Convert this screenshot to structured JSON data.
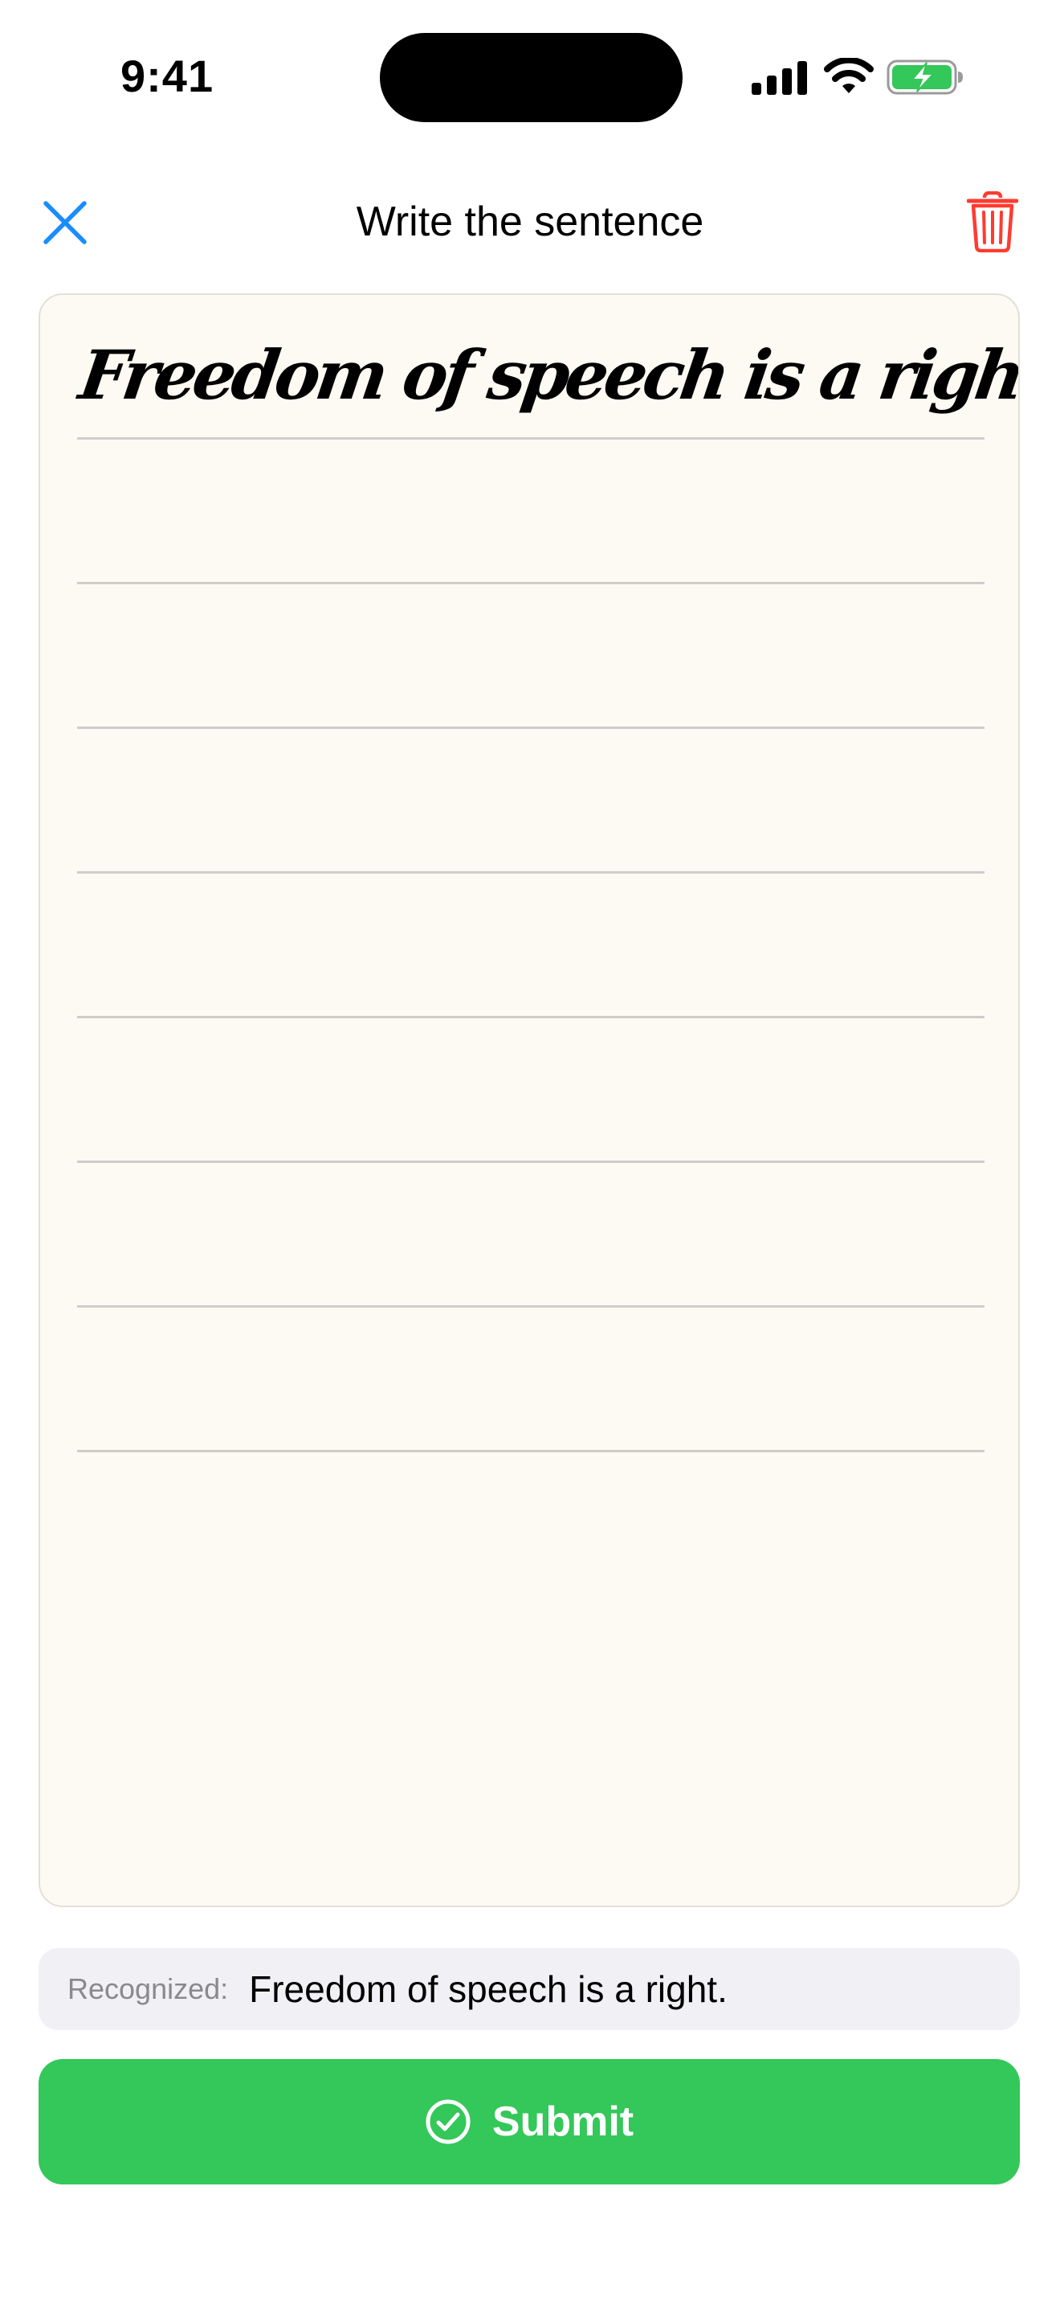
{
  "status_bar": {
    "time": "9:41",
    "icons": [
      "cellular-signal-icon",
      "wifi-icon",
      "battery-charging-icon"
    ]
  },
  "nav": {
    "title": "Write the sentence",
    "close_icon": "close-icon",
    "delete_icon": "trash-icon"
  },
  "writing_area": {
    "prompt_sentence": "Freedom of speech is a right.",
    "ruled_line_count": 8
  },
  "recognized": {
    "label": "Recognized:",
    "text": "Freedom of speech is a right."
  },
  "submit": {
    "label": "Submit",
    "icon": "checkmark-circle-icon"
  },
  "colors": {
    "accent_blue": "#1a8cff",
    "delete_red": "#ff3b30",
    "submit_green": "#34c759",
    "paper": "#fdfaf3",
    "battery_green": "#34c759"
  }
}
